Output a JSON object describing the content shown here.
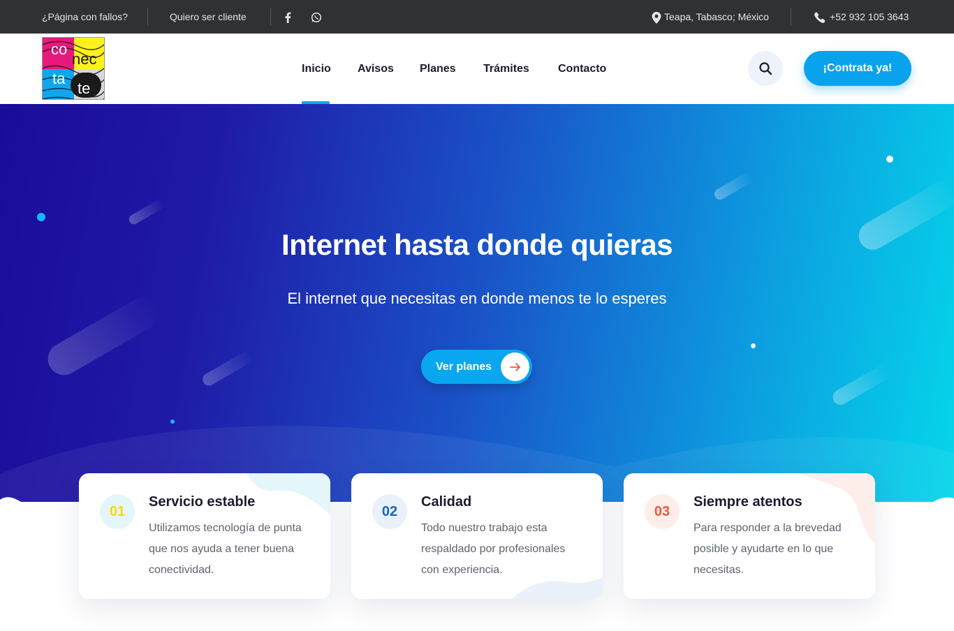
{
  "topbar": {
    "bug_report": "¿Página con fallos?",
    "become_client": "Quiero ser cliente",
    "location": "Teapa, Tabasco; México",
    "phone": "+52 932 105 3643"
  },
  "logo": {
    "parts": [
      "co",
      "nec",
      "ta",
      "te"
    ],
    "colors": [
      "#e8197e",
      "#fff21c",
      "#10a6ee",
      "#1a1a1a"
    ]
  },
  "nav": {
    "items": [
      "Inicio",
      "Avisos",
      "Planes",
      "Trámites",
      "Contacto"
    ],
    "active": "Inicio"
  },
  "header": {
    "cta_label": "¡Contrata ya!"
  },
  "hero": {
    "title": "Internet hasta donde quieras",
    "subtitle": "El internet que necesitas en donde menos te lo esperes",
    "button_label": "Ver planes"
  },
  "features": [
    {
      "number": "01",
      "title": "Servicio estable",
      "description": "Utilizamos tecnología de punta que nos ayuda a tener buena conectividad.",
      "accent": "#f6d80a",
      "accent_bg": "#e5f6fb"
    },
    {
      "number": "02",
      "title": "Calidad",
      "description": "Todo nuestro trabajo esta respaldado por profesionales con experiencia.",
      "accent": "#1565c0",
      "accent_bg": "#eaf1fb"
    },
    {
      "number": "03",
      "title": "Siempre atentos",
      "description": "Para responder a la brevedad posible y ayudarte en lo que necesitas.",
      "accent": "#f05a3a",
      "accent_bg": "#fdeee9"
    }
  ],
  "colors": {
    "topbar_bg": "#2f3133",
    "primary": "#0aa2ec",
    "hero_start": "#1a0c9a",
    "hero_end": "#05d6ea"
  }
}
